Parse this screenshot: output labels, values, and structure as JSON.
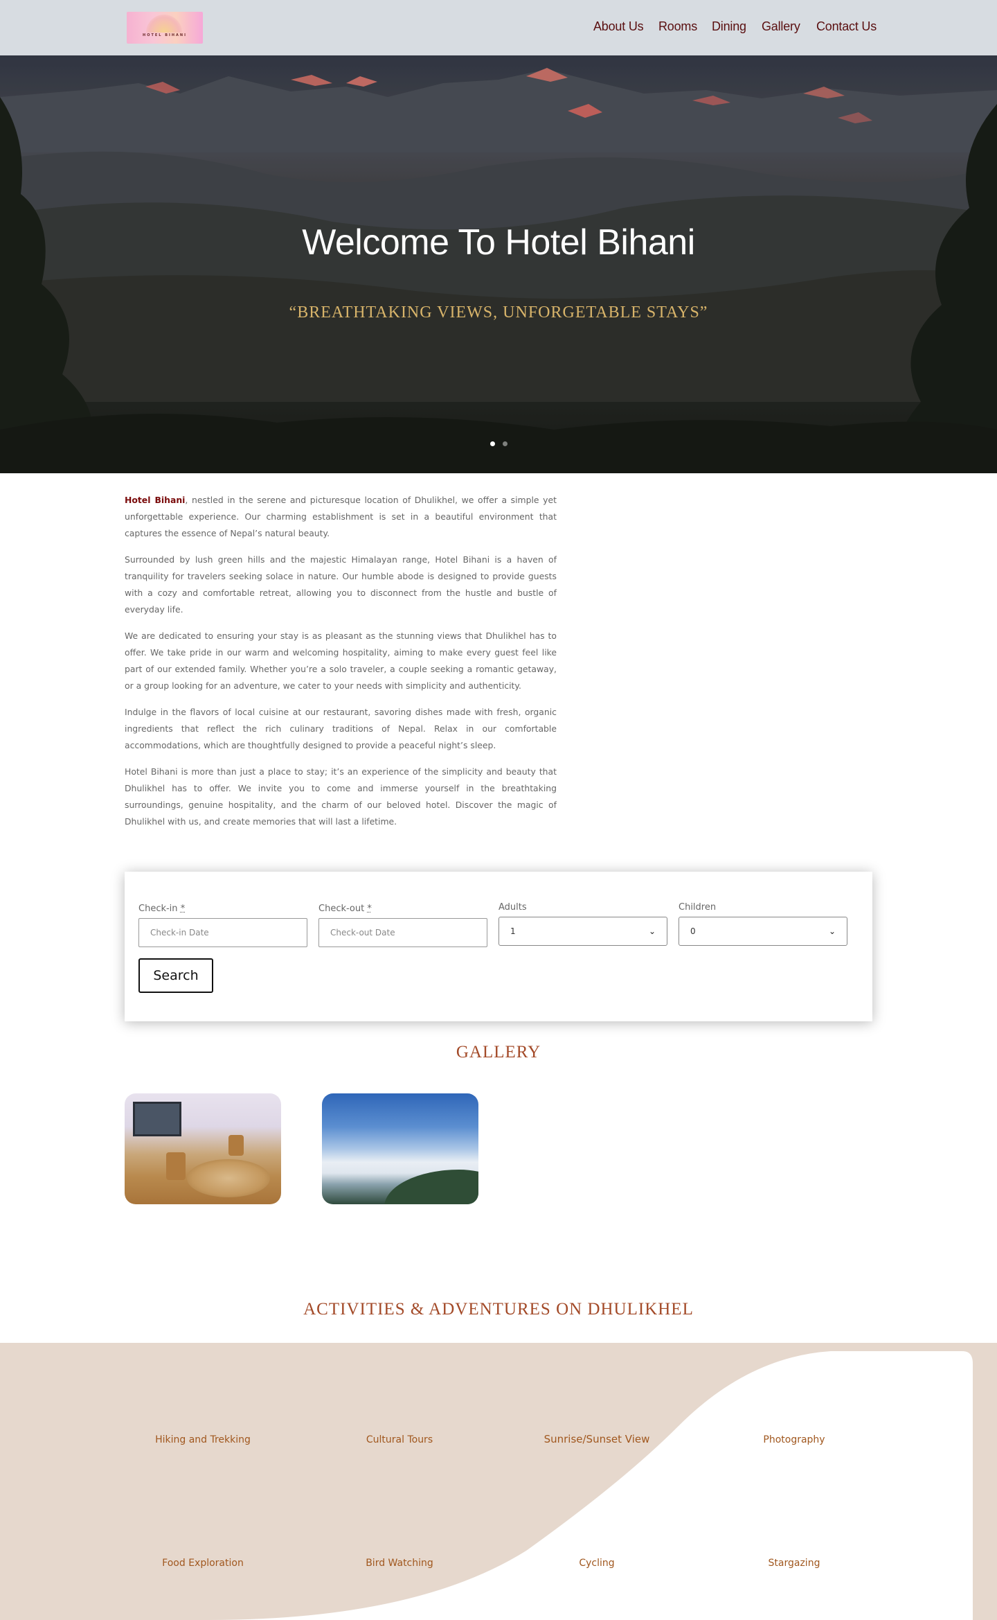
{
  "header": {
    "logo_text": "HOTEL BIHANI",
    "nav": [
      "About Us",
      "Rooms",
      "Dining",
      "Gallery",
      "Contact Us"
    ]
  },
  "hero": {
    "title": "Welcome To Hotel Bihani",
    "subtitle": "“BREATHTAKING VIEWS, UNFORGETABLE STAYS”",
    "slide_count": 2,
    "active_slide": 1
  },
  "intro": {
    "p1_bold": "Hotel Bihani",
    "p1_rest": ", nestled in the serene and picturesque location of Dhulikhel, we offer a simple yet unforgettable experience. Our charming establishment is set in a beautiful environment that captures the essence of Nepal’s natural beauty.",
    "p2": "Surrounded by lush green hills and the majestic Himalayan range, Hotel Bihani is a haven of tranquility for travelers seeking solace in nature. Our humble abode is designed to provide guests with a cozy and comfortable retreat, allowing you to disconnect from the hustle and bustle of everyday life.",
    "p3": "We are dedicated to ensuring your stay is as pleasant as the stunning views that Dhulikhel has to offer. We take pride in our warm and welcoming hospitality, aiming to make every guest feel like part of our extended family. Whether you’re a solo traveler, a couple seeking a romantic getaway, or a group looking for an adventure, we cater to your needs with simplicity and authenticity.",
    "p4": "Indulge in the flavors of local cuisine at our restaurant, savoring dishes made with fresh, organic ingredients that reflect the rich culinary traditions of Nepal. Relax in our comfortable accommodations, which are thoughtfully designed to provide a peaceful night’s sleep.",
    "p5": "Hotel Bihani is more than just a place to stay; it’s an experience of the simplicity and beauty that Dhulikhel has to offer. We invite you to come and immerse yourself in the breathtaking surroundings, genuine hospitality, and the charm of our beloved hotel. Discover the magic of Dhulikhel with us, and create memories that will last a lifetime."
  },
  "booking": {
    "checkin_label": "Check-in",
    "checkin_placeholder": "Check-in Date",
    "checkout_label": "Check-out",
    "checkout_placeholder": "Check-out Date",
    "required_mark": "*",
    "adults_label": "Adults",
    "adults_value": "1",
    "children_label": "Children",
    "children_value": "0",
    "search_label": "Search"
  },
  "gallery": {
    "title": "GALLERY"
  },
  "activities": {
    "title": "ACTIVITIES & ADVENTURES ON DHULIKHEL",
    "row1": [
      "Hiking and Trekking",
      "Cultural Tours",
      "Sunrise/Sunset View",
      "Photography"
    ],
    "row2": [
      "Food Exploration",
      "Bird Watching",
      "Cycling",
      "Stargazing"
    ]
  },
  "colors": {
    "nav_text": "#5a0f10",
    "accent_gold": "#d8b46a",
    "section_title": "#a34a28",
    "activity_text": "#a0571e",
    "activities_bg": "#e6d8cd"
  }
}
